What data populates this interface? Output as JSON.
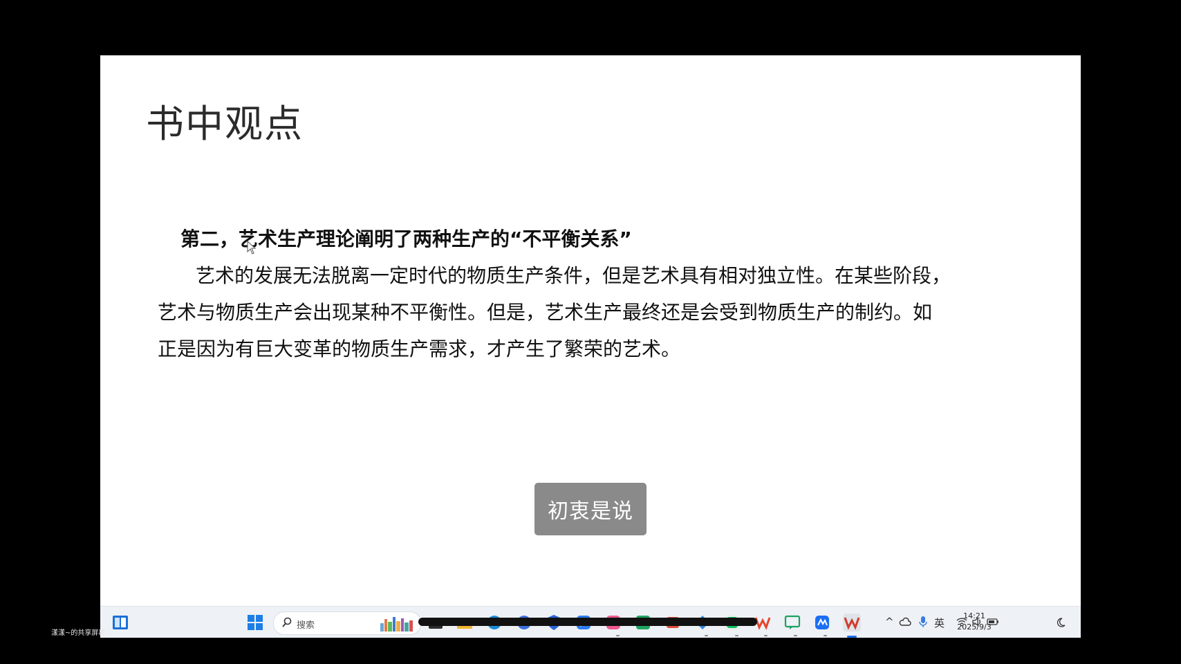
{
  "slide": {
    "title": "书中观点",
    "heading": "第二，艺术生产理论阐明了两种生产的“不平衡关系”",
    "body_lines": [
      "艺术的发展无法脱离一定时代的物质生产条件，但是艺术具有相对独立性。在某些阶段，",
      "艺术与物质生产会出现某种不平衡性。但是，艺术生产最终还是会受到物质生产的制约。如",
      "正是因为有巨大变革的物质生产需求，才产生了繁荣的艺术。"
    ]
  },
  "subtitle": "初衷是说",
  "taskbar": {
    "search_placeholder": "搜索",
    "input_method": "英",
    "time": "14:21",
    "date": "2025/9/3",
    "icons": [
      "widgets-icon",
      "windows-start-icon",
      "search-icon",
      "file-explorer-icon",
      "folder-icon",
      "edge-icon",
      "browser-icon",
      "shield-icon",
      "app-blue-icon",
      "app-pink-icon",
      "app-green-icon",
      "app-red-icon",
      "app-diamond-icon",
      "wechat-icon",
      "wps-icon",
      "chat-icon",
      "meeting-icon",
      "wps-presentation-icon"
    ]
  },
  "share_label": "漾漾~的共享屏幕",
  "colors": {
    "background": "#000000",
    "slide": "#ffffff",
    "subtitle_bg": "#8a8a8a",
    "taskbar": "#eef1f5"
  }
}
